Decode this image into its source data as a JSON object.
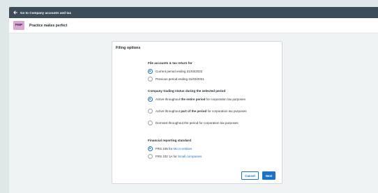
{
  "topbar": {
    "back_label": "Go to Company accounts and tax"
  },
  "company": {
    "initials": "PMP",
    "name": "Practice makes perfect"
  },
  "card": {
    "title": "Filing options",
    "sections": [
      {
        "title": "File accounts & tax return for",
        "options": [
          {
            "label": "Current period ending 31/03/2022",
            "checked": true
          },
          {
            "label": "Previous period ending 31/03/2021",
            "checked": false
          }
        ]
      },
      {
        "title": "Company trading status during the selected period",
        "options": [
          {
            "pre": "Active throughout ",
            "bold": "the entire period",
            "post": " for corporation tax purposes",
            "checked": true
          },
          {
            "pre": "Active throughout ",
            "bold": "part of the period",
            "post": " for corporation tax purposes",
            "checked": false
          },
          {
            "pre": "Dormant throughout the period for corporation tax purposes",
            "bold": "",
            "post": "",
            "checked": false
          }
        ]
      },
      {
        "title": "Financial reporting standard",
        "options": [
          {
            "pre": "FRS 105 for ",
            "link": "Micro-entities",
            "checked": true
          },
          {
            "pre": "FRS 102 1A for ",
            "link": "Small companies",
            "checked": false
          }
        ]
      }
    ],
    "cancel_label": "Cancel",
    "next_label": "Next"
  },
  "colors": {
    "accent": "#1a73c8",
    "topbar": "#3c4d59",
    "avatar": "#d9a7d6"
  }
}
